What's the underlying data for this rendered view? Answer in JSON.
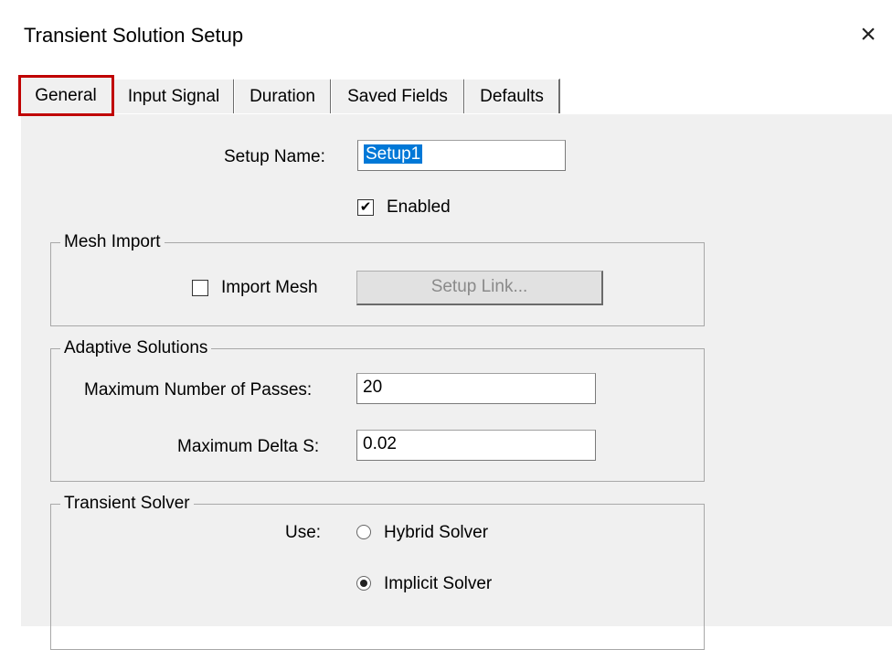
{
  "window": {
    "title": "Transient Solution Setup",
    "close_label": "×"
  },
  "tabs": [
    {
      "label": "General",
      "active": true
    },
    {
      "label": "Input Signal",
      "active": false
    },
    {
      "label": "Duration",
      "active": false
    },
    {
      "label": "Saved Fields",
      "active": false
    },
    {
      "label": "Defaults",
      "active": false
    }
  ],
  "general": {
    "setup_name_label": "Setup Name:",
    "setup_name_value": "Setup1",
    "enabled_label": "Enabled",
    "enabled_checked": true
  },
  "mesh_import": {
    "group_label": "Mesh Import",
    "import_mesh_label": "Import Mesh",
    "import_mesh_checked": false,
    "setup_link_label": "Setup Link..."
  },
  "adaptive": {
    "group_label": "Adaptive Solutions",
    "max_passes_label": "Maximum Number of Passes:",
    "max_passes_value": "20",
    "max_delta_label": "Maximum Delta S:",
    "max_delta_value": "0.02"
  },
  "transient_solver": {
    "group_label": "Transient Solver",
    "use_label": "Use:",
    "hybrid_label": "Hybrid Solver",
    "implicit_label": "Implicit Solver",
    "selected": "implicit"
  },
  "colors": {
    "highlight": "#c00000",
    "selection": "#0078d7",
    "panel": "#f0f0f0"
  }
}
